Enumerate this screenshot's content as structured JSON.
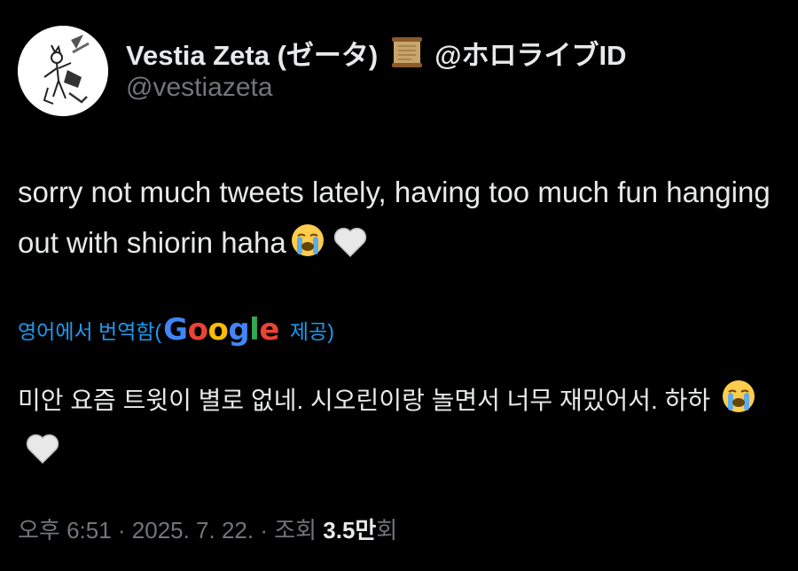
{
  "author": {
    "display_name": "Vestia Zeta (ゼータ)",
    "badge_icon": "scroll-icon",
    "affiliation": "@ホロライブID",
    "handle": "@vestiazeta"
  },
  "tweet": {
    "text": "sorry not much tweets lately, having too much fun hanging out with shiorin haha",
    "emojis": [
      "loudly-crying-face",
      "white-heart"
    ]
  },
  "translation": {
    "link_label": "영어에서 번역함(",
    "provider_letters": [
      "G",
      "o",
      "o",
      "g",
      "l",
      "e"
    ],
    "provider_colors": [
      "#4285f4",
      "#ea4335",
      "#fbbc05",
      "#4285f4",
      "#34a853",
      "#ea4335"
    ],
    "provided_label": "제공)",
    "text": "미안 요즘 트윗이 별로 없네. 시오린이랑 놀면서 너무 재밌어서. 하하"
  },
  "meta": {
    "time_date": "오후 6:51 · 2025. 7. 22. · 조회 ",
    "views_count": "3.5만",
    "views_suffix": "회"
  },
  "colors": {
    "background": "#000000",
    "text_primary": "#e7e9ea",
    "text_secondary": "#71767b",
    "link": "#1d9bf0"
  }
}
